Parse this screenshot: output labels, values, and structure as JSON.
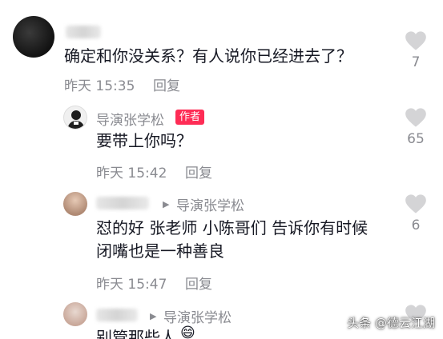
{
  "comments": [
    {
      "author": "",
      "text": "确定和你没关系？有人说你已经进去了？",
      "time": "昨天 15:35",
      "reply_label": "回复",
      "likes": "7"
    },
    {
      "author": "导演张学松",
      "author_badge": "作者",
      "text": "要带上你吗？",
      "time": "昨天 15:42",
      "reply_label": "回复",
      "likes": "65"
    },
    {
      "author": "",
      "reply_target": "导演张学松",
      "text_lines": [
        "怼的好 张老师 小陈哥们 告诉你有时候",
        "闭嘴也是一种善良"
      ],
      "time": "昨天 15:47",
      "reply_label": "回复",
      "likes": "6"
    },
    {
      "author": "",
      "reply_target": "导演张学松",
      "text": "别管那些人"
    }
  ],
  "watermark": "头条 @德云江湖"
}
